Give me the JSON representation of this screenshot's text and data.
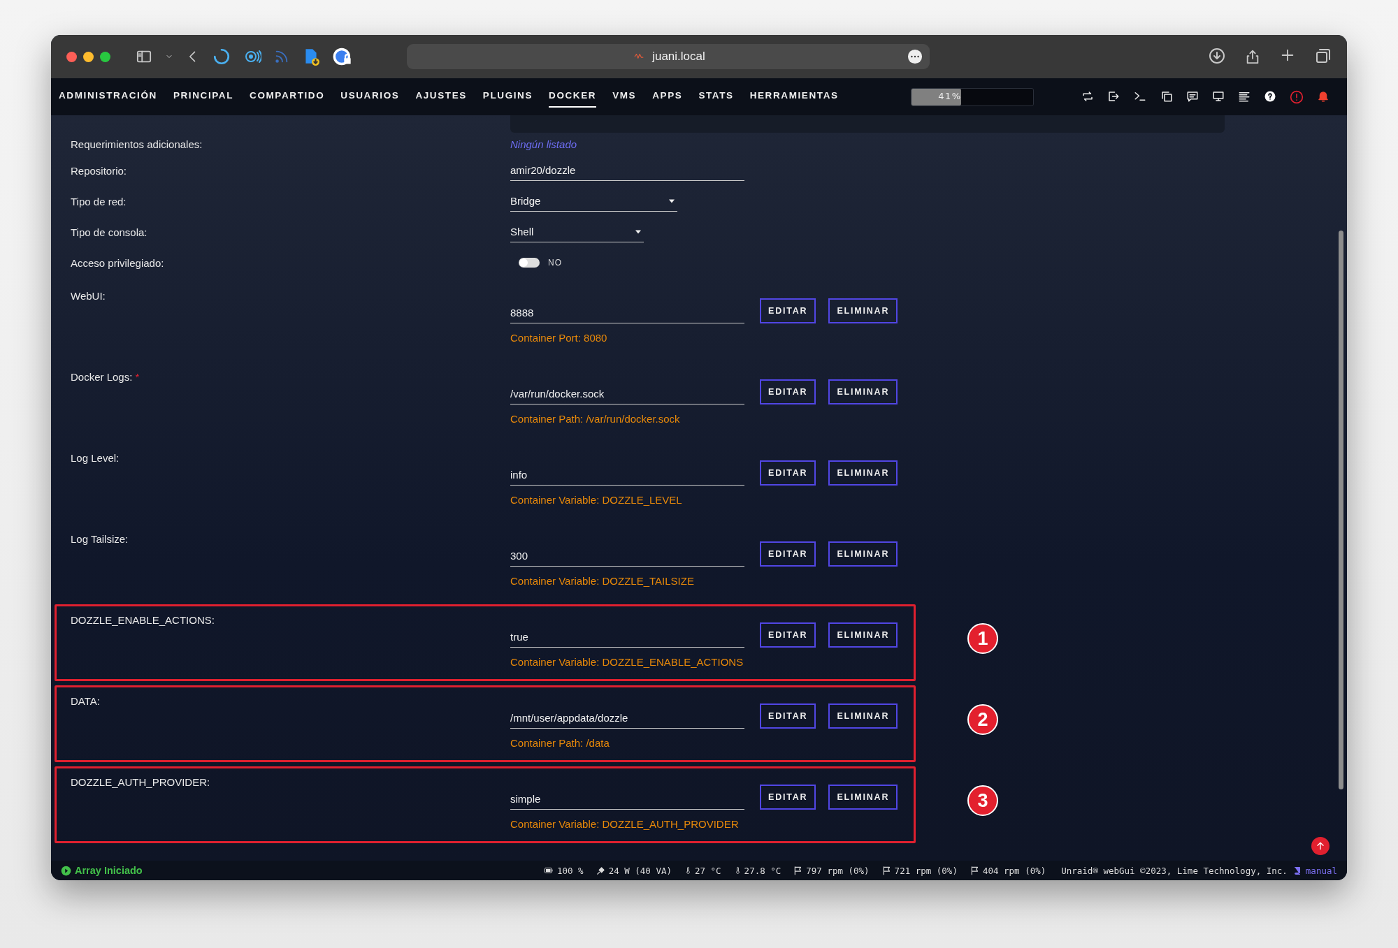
{
  "browser": {
    "url": "juani.local"
  },
  "nav": {
    "items": [
      {
        "label": "ADMINISTRACIÓN",
        "selected": false
      },
      {
        "label": "PRINCIPAL",
        "selected": false
      },
      {
        "label": "COMPARTIDO",
        "selected": false
      },
      {
        "label": "USUARIOS",
        "selected": false
      },
      {
        "label": "AJUSTES",
        "selected": false
      },
      {
        "label": "PLUGINS",
        "selected": false
      },
      {
        "label": "DOCKER",
        "selected": true
      },
      {
        "label": "VMS",
        "selected": false
      },
      {
        "label": "APPS",
        "selected": false
      },
      {
        "label": "STATS",
        "selected": false
      },
      {
        "label": "HERRAMIENTAS",
        "selected": false
      }
    ],
    "load": {
      "label": "41%",
      "level": 0.41
    }
  },
  "fields": [
    {
      "kind": "note",
      "label": "Requerimientos adicionales:",
      "value": "Ningún listado"
    },
    {
      "kind": "text",
      "label": "Repositorio:",
      "value": "amir20/dozzle"
    },
    {
      "kind": "select",
      "label": "Tipo de red:",
      "value": "Bridge"
    },
    {
      "kind": "select",
      "label": "Tipo de consola:",
      "value": "Shell"
    },
    {
      "kind": "toggle",
      "label": "Acceso privilegiado:",
      "on": false,
      "text": "NO"
    }
  ],
  "config": [
    {
      "label": "WebUI:",
      "value": "8888",
      "description": "Container Port: 8080",
      "buttons": [
        "EDITAR",
        "ELIMINAR"
      ]
    },
    {
      "label": "Docker Logs:",
      "required_mark": "*",
      "value": "/var/run/docker.sock",
      "description": "Container Path: /var/run/docker.sock",
      "buttons": [
        "EDITAR",
        "ELIMINAR"
      ]
    },
    {
      "label": "Log Level:",
      "value": "info",
      "description": "Container Variable: DOZZLE_LEVEL",
      "buttons": [
        "EDITAR",
        "ELIMINAR"
      ]
    },
    {
      "label": "Log Tailsize:",
      "value": "300",
      "description": "Container Variable: DOZZLE_TAILSIZE",
      "buttons": [
        "EDITAR",
        "ELIMINAR"
      ]
    },
    {
      "label": "DOZZLE_ENABLE_ACTIONS:",
      "value": "true",
      "description": "Container Variable: DOZZLE_ENABLE_ACTIONS",
      "buttons": [
        "EDITAR",
        "ELIMINAR"
      ],
      "callout": "1"
    },
    {
      "label": "DATA:",
      "value": "/mnt/user/appdata/dozzle",
      "description": "Container Path: /data",
      "buttons": [
        "EDITAR",
        "ELIMINAR"
      ],
      "callout": "2"
    },
    {
      "label": "DOZZLE_AUTH_PROVIDER:",
      "value": "simple",
      "description": "Container Variable: DOZZLE_AUTH_PROVIDER",
      "buttons": [
        "EDITAR",
        "ELIMINAR"
      ],
      "callout": "3"
    }
  ],
  "status_bar": {
    "array_status": "Array Iniciado",
    "items": [
      {
        "kind": "battery",
        "text": "100 %"
      },
      {
        "kind": "power",
        "text": "24 W (40 VA)"
      },
      {
        "kind": "temp",
        "text": "27 °C"
      },
      {
        "kind": "temp",
        "text": "27.8 °C"
      },
      {
        "kind": "fan",
        "text": "797 rpm (0%)"
      },
      {
        "kind": "fan",
        "text": "721 rpm (0%)"
      },
      {
        "kind": "fan",
        "text": "404 rpm (0%)"
      }
    ],
    "copyright": "Unraid® webGui ©2023, Lime Technology, Inc.",
    "manual": "manual"
  }
}
